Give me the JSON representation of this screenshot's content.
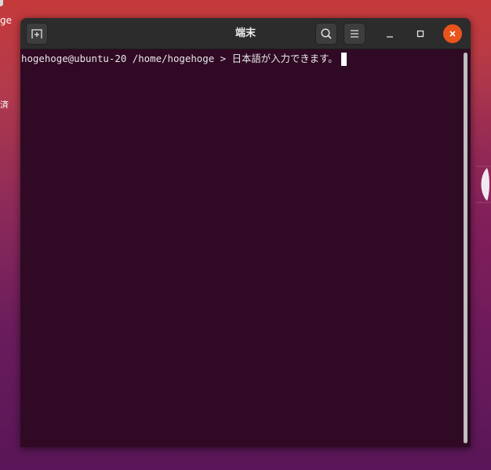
{
  "desktop": {
    "label_top": "ge",
    "label_mid": "済"
  },
  "window": {
    "title": "端末",
    "buttons": {
      "new_tab_icon": "new-tab-icon",
      "search_icon": "search-icon",
      "menu_icon": "hamburger-menu-icon",
      "minimize_icon": "minimize-icon",
      "maximize_icon": "maximize-icon",
      "close_icon": "close-icon"
    },
    "colors": {
      "headerbar": "#2c2c2c",
      "terminal_bg": "#300a24",
      "close_button": "#e9541c"
    }
  },
  "terminal": {
    "prompt": "hogehoge@ubuntu-20 /home/hogehoge > ",
    "input": "日本語が入力できます。"
  }
}
